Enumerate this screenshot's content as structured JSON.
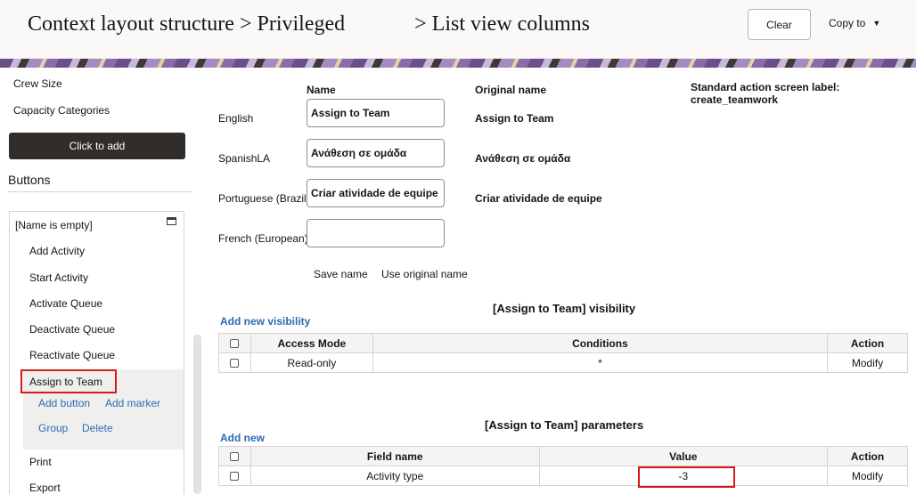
{
  "header": {
    "title": "Context layout structure > Privileged             > List view columns",
    "clear_label": "Clear",
    "copy_to_label": "Copy to"
  },
  "sidebar": {
    "top_items": [
      "Crew Size",
      "Capacity Categories"
    ],
    "click_to_add": "Click to add",
    "buttons_heading": "Buttons",
    "tree_root": "[Name is empty]",
    "tree_items": [
      "Add Activity",
      "Start Activity",
      "Activate Queue",
      "Deactivate Queue",
      "Reactivate Queue",
      "Assign to Team"
    ],
    "selected_actions": [
      "Add button",
      "Add marker",
      "Group",
      "Delete"
    ],
    "after_items": [
      "Print",
      "Export"
    ]
  },
  "names": {
    "name_header": "Name",
    "original_header": "Original name",
    "std_label_title": "Standard action screen label:",
    "std_label_value": "create_teamwork",
    "rows": [
      {
        "lang": "English",
        "value": "Assign to Team",
        "original": "Assign to Team"
      },
      {
        "lang": "SpanishLA",
        "value": "Ανάθεση σε ομάδα",
        "original": "Ανάθεση σε ομάδα"
      },
      {
        "lang": "Portuguese (Brazil)",
        "value": "Criar atividade de equipe",
        "original": "Criar atividade de equipe"
      },
      {
        "lang": "French (European)",
        "value": "",
        "original": ""
      }
    ],
    "save_name": "Save name",
    "use_original": "Use original name"
  },
  "visibility": {
    "title": "[Assign to Team] visibility",
    "add_link": "Add new visibility",
    "headers": [
      "Access Mode",
      "Conditions",
      "Action"
    ],
    "rows": [
      {
        "mode": "Read-only",
        "conditions": "*",
        "action": "Modify"
      }
    ]
  },
  "parameters": {
    "title": "[Assign to Team] parameters",
    "add_link": "Add new",
    "headers": [
      "Field name",
      "Value",
      "Action"
    ],
    "rows": [
      {
        "field": "Activity type",
        "value": "-3",
        "action": "Modify"
      }
    ]
  }
}
